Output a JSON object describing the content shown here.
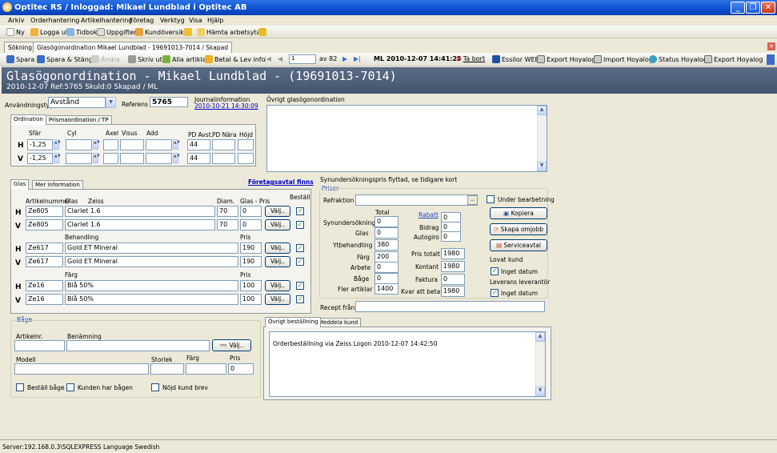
{
  "window": {
    "title": "Optitec RS / Inloggad: Mikael Lundblad i  Optitec AB"
  },
  "menu": [
    "Arkiv",
    "Orderhantering",
    "Artikelhantering",
    "Företag",
    "Verktyg",
    "Visa",
    "Hjälp"
  ],
  "toolbar1": [
    "Ny",
    "Logga ut",
    "Tidbok",
    "Uppgifter",
    "Kundöversikt",
    "Hämta arbetsyta"
  ],
  "tabs": [
    "Sökning",
    "Glasögonordination Mikael Lundblad - 19691013-7014 / Skapad"
  ],
  "toolbar2": {
    "spara": "Spara",
    "spara_stang": "Spara & Stäng",
    "andra": "Ändra",
    "skriv_ut": "Skriv ut",
    "alla_artiklar": "Alla artiklar",
    "betal": "Betal & Lev info",
    "page": "1",
    "of": "av 82",
    "ml": "ML 2010-12-07 14:41:23",
    "ta_bort": "Ta bort",
    "essilor": "Essilor WEB",
    "export_hoyalog": "Export Hoyalog",
    "import_hoyalog": "Import Hoyalog",
    "status_hoyalog": "Status Hoyalog",
    "export_hoyalog2": "Export Hoyalog"
  },
  "header": {
    "title": "Glasögonordination - Mikael Lundblad - (19691013-7014)",
    "subtitle": "2010-12-07 Ref:5765  Skuld:0 Skapad / ML"
  },
  "top": {
    "anvandningstyp_label": "Användningstyp",
    "anvandningstyp_value": "Avstånd",
    "referens_label": "Referens",
    "referens_value": "5765",
    "journal_label": "Journalinformation",
    "journal_value": "2010-10-21 14:30:09",
    "ovrigt_label": "Övrigt glasögonordination"
  },
  "ordination": {
    "tab1": "Ordination",
    "tab2": "Prismaordination / TP",
    "col_sfar": "Sfär",
    "col_cyl": "Cyl",
    "col_axel": "Axel",
    "col_visus": "Visus",
    "col_add": "Add",
    "col_pdavst": "PD Avst.",
    "col_pdnara": "PD Nära",
    "col_hojd": "Höjd",
    "row_h": "H",
    "row_v": "V",
    "h_sfar": "-1,25",
    "v_sfar": "-1,25",
    "h_pd": "44",
    "v_pd": "44"
  },
  "glas": {
    "tab1": "Glas",
    "tab2": "Mer information",
    "foretagsavtal": "Företagsavtal finns",
    "col_artikelnummer": "Artikelnummer",
    "col_glas": "Glas",
    "col_zeiss": "Zeiss",
    "col_diam": "Diam.",
    "col_glaspris": "Glas - Pris",
    "col_bestall": "Beställ",
    "behandling": "Behandling",
    "pris": "Pris",
    "farg": "Färg",
    "valj": "Välj..",
    "rows": [
      {
        "side": "H",
        "art": "Ze805",
        "name": "Clarlet 1.6",
        "diam": "70",
        "price": "0"
      },
      {
        "side": "V",
        "art": "Ze805",
        "name": "Clarlet 1.6",
        "diam": "70",
        "price": "0"
      },
      {
        "side": "H",
        "art": "Ze617",
        "name": "Gold ET Mineral",
        "price": "190"
      },
      {
        "side": "V",
        "art": "Ze617",
        "name": "Gold ET Mineral",
        "price": "190"
      },
      {
        "side": "H",
        "art": "Ze16",
        "name": "Blå 50%",
        "price": "100"
      },
      {
        "side": "V",
        "art": "Ze16",
        "name": "Blå 50%",
        "price": "100"
      }
    ]
  },
  "priser": {
    "note": "Synundersökningspris flyttad, se tidigare kort",
    "title": "Priser",
    "refraktion": "Refraktion",
    "under_bearbetning": "Under bearbetning",
    "total": "Total",
    "rabatt": "Rabatt",
    "synundersokning": "Synundersökning",
    "synundersokning_v": "0",
    "glas": "Glas",
    "glas_v": "0",
    "ytbehandling": "Ytbehandling",
    "ytbehandling_v": "380",
    "farg": "Färg",
    "farg_v": "200",
    "arbete": "Arbete",
    "arbete_v": "0",
    "bage": "Båge",
    "bage_v": "0",
    "fler": "Fler artiklar",
    "fler_v": "1400",
    "rabatt_v": "0",
    "bidrag": "Bidrag",
    "bidrag_v": "0",
    "autogiro": "Autogiro",
    "autogiro_v": "0",
    "pristotalt": "Pris totalt",
    "pristotalt_v": "1980",
    "kontant": "Kontant",
    "kontant_v": "1980",
    "faktura": "Faktura",
    "faktura_v": "0",
    "kvar": "Kvar att betala",
    "kvar_v": "1980",
    "kopiera": "Kopiera",
    "skapa_omjobb": "Skapa omjobb",
    "serviceavtal": "Serviceavtal",
    "lovat_kund": "Lovat kund",
    "inget_datum": "Inget datum",
    "leverans": "Leverans leverantör",
    "recept_fran": "Recept från"
  },
  "bage": {
    "title": "Båge",
    "artikelnr": "Artikelnr.",
    "benamning": "Benämning",
    "valj": "Välj..",
    "modell": "Modell",
    "storlek": "Storlek",
    "farg": "Färg",
    "pris": "Pris",
    "pris_v": "0",
    "bestall_bage": "Beställ båge",
    "kunden_har": "Kunden har bågen",
    "nojd": "Nöjd kund brev"
  },
  "ovrigt": {
    "tab1": "Övrigt beställning",
    "tab2": "Meddela kund",
    "text": "Orderbeställning via Zeiss Logon 2010-12-07 14:42:50"
  },
  "status": {
    "text": "Server:192.168.0.3\\SQLEXPRESS  Language  Swedish"
  },
  "colors": {
    "titlebar": "#0a4fd0",
    "header": "#4b5b74",
    "link": "#0000cc",
    "group_title": "#1f48c7"
  }
}
